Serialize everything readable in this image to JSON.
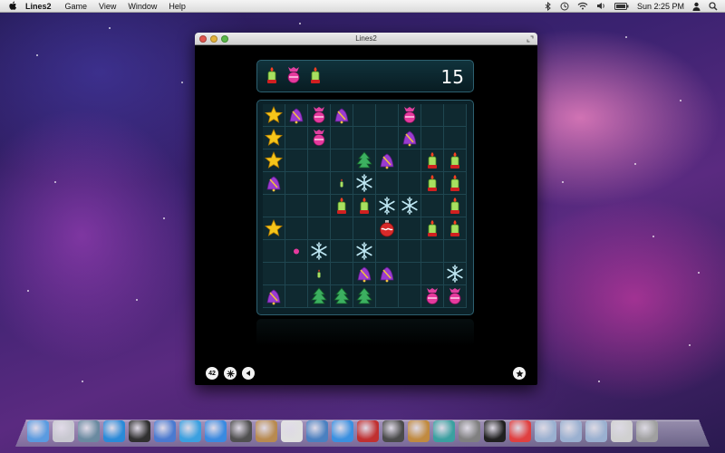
{
  "menubar": {
    "app_name": "Lines2",
    "menus": [
      "Game",
      "View",
      "Window",
      "Help"
    ],
    "clock": "Sun 2:25 PM"
  },
  "window": {
    "title": "Lines2",
    "score": "15",
    "next_pieces": [
      "candle",
      "candy",
      "candle"
    ],
    "toolbar": {
      "counter_label": "42"
    }
  },
  "board": {
    "rows": [
      [
        "star",
        "bell",
        "candy",
        "bell",
        "",
        "",
        "candy",
        "",
        ""
      ],
      [
        "star",
        "",
        "candy",
        "",
        "",
        "",
        "bell",
        "",
        ""
      ],
      [
        "star",
        "",
        "",
        "",
        "tree",
        "bell",
        "",
        "candle",
        "candle"
      ],
      [
        "bell",
        "",
        "",
        "tiny-candle",
        "snowflake",
        "",
        "",
        "candle",
        "candle"
      ],
      [
        "",
        "",
        "",
        "candle",
        "candle",
        "snowflake",
        "snowflake",
        "",
        "candle"
      ],
      [
        "star",
        "",
        "",
        "",
        "",
        "ornament",
        "",
        "candle",
        "candle"
      ],
      [
        "",
        "tiny-candy",
        "snowflake",
        "",
        "snowflake",
        "",
        "",
        "",
        ""
      ],
      [
        "",
        "",
        "tiny-candle",
        "",
        "bell",
        "bell",
        "",
        "",
        "snowflake"
      ],
      [
        "bell",
        "",
        "tree",
        "tree",
        "tree",
        "",
        "",
        "candy",
        "candy"
      ]
    ]
  },
  "colors": {
    "board_background": "#0b2128",
    "cell_background": "#0f2930",
    "grid_line": "#1f4650",
    "frame": "#2d6070"
  },
  "dock": {
    "icons": [
      "finder-icon",
      "launchpad-icon",
      "photo-booth-icon",
      "app-store-icon",
      "dashboard-icon",
      "preview-icon",
      "safari-icon",
      "ichat-icon",
      "facetime-icon",
      "address-book-icon",
      "ical-icon",
      "iphoto-icon",
      "itunes-icon",
      "photo-icon",
      "imovie-icon",
      "garageband-icon",
      "time-machine-icon",
      "system-preferences-icon",
      "terminal-icon",
      "colors-icon",
      "folder-icon",
      "documents-icon",
      "downloads-icon",
      "applications-icon",
      "trash-icon"
    ]
  }
}
